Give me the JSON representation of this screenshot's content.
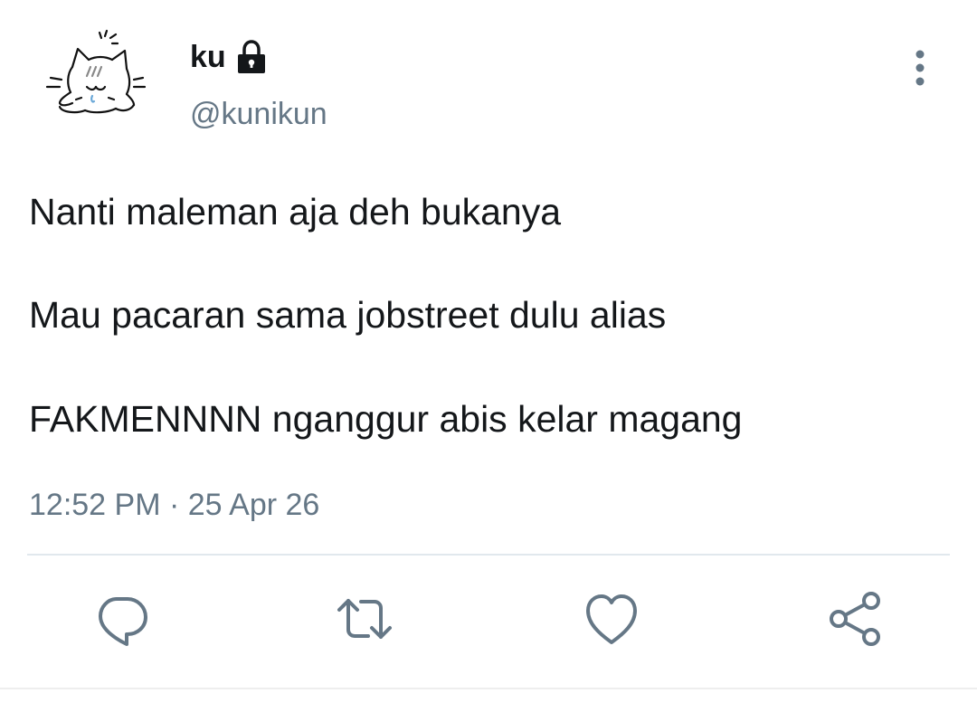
{
  "user": {
    "display_name": "ku",
    "handle": "@kunikun",
    "protected": true,
    "avatar_icon": "cat-sketch-avatar"
  },
  "tweet": {
    "lines": [
      "Nanti maleman aja deh bukanya",
      "Mau pacaran sama jobstreet dulu alias",
      "FAKMENNNN nganggur abis kelar magang"
    ],
    "time": "12:52 PM",
    "separator": "·",
    "date": "25 Apr 26"
  },
  "actions": {
    "reply_icon": "reply-icon",
    "retweet_icon": "retweet-icon",
    "like_icon": "heart-icon",
    "share_icon": "share-icon"
  },
  "colors": {
    "text": "#14171a",
    "secondary": "#657786",
    "divider": "#e1e8ed"
  }
}
